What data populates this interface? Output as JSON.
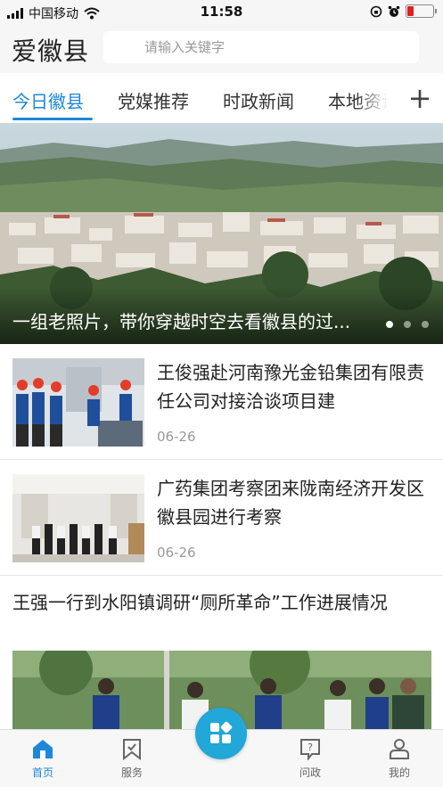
{
  "status_bar": {
    "carrier": "中国移动",
    "time": "11:58"
  },
  "header": {
    "logo": "爱徽县",
    "search_placeholder": "请输入关键字"
  },
  "tabs": [
    {
      "label": "今日徽县",
      "active": true
    },
    {
      "label": "党媒推荐",
      "active": false
    },
    {
      "label": "时政新闻",
      "active": false
    },
    {
      "label": "本地资讯",
      "active": false
    }
  ],
  "tabs_add_label": "+",
  "banner": {
    "caption": "一组老照片，带你穿越时空去看徽县的过...",
    "slides": 3,
    "active_slide": 0
  },
  "news": [
    {
      "title": "王俊强赴河南豫光金铅集团有限责任公司对接洽谈项目建",
      "date": "06-26"
    },
    {
      "title": "广药集团考察团来陇南经济开发区徽县园进行考察",
      "date": "06-26"
    },
    {
      "title": "王强一行到水阳镇调研“厕所革命”工作进展情况"
    }
  ],
  "bottom_nav": [
    {
      "label": "首页",
      "icon": "home-icon",
      "active": true
    },
    {
      "label": "服务",
      "icon": "bookmark-icon",
      "active": false
    },
    {
      "label": "问政",
      "icon": "question-chat-icon",
      "active": false
    },
    {
      "label": "我的",
      "icon": "user-icon",
      "active": false
    }
  ],
  "colors": {
    "accent": "#1e88d8",
    "center_button": "#21a7d8",
    "battery": "#e02020"
  }
}
